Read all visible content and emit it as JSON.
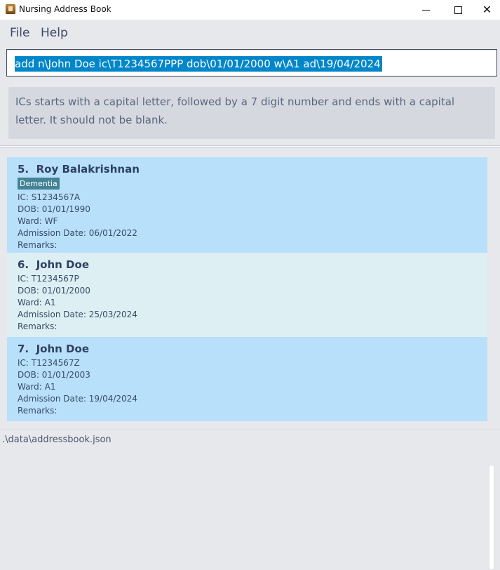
{
  "window": {
    "title": "Nursing Address Book",
    "minimize_symbol": "—",
    "maximize_symbol": "□",
    "close_symbol": "✕"
  },
  "menu": {
    "items": [
      "File",
      "Help"
    ]
  },
  "command": {
    "text": "add n\\John Doe ic\\T1234567PPP dob\\01/01/2000 w\\A1 ad\\19/04/2024"
  },
  "result": {
    "message": "ICs starts with a capital letter, followed by a 7 digit number and ends with a capital letter. It should not be blank."
  },
  "patients": [
    {
      "index": "5.",
      "name": "Roy Balakrishnan",
      "tag": "Dementia",
      "ic": "IC: S1234567A",
      "dob": "DOB: 01/01/1990",
      "ward": "Ward: WF",
      "admission": "Admission Date: 06/01/2022",
      "remarks": "Remarks:"
    },
    {
      "index": "6.",
      "name": "John Doe",
      "ic": "IC: T1234567P",
      "dob": "DOB: 01/01/2000",
      "ward": "Ward: A1",
      "admission": "Admission Date: 25/03/2024",
      "remarks": "Remarks:"
    },
    {
      "index": "7.",
      "name": "John Doe",
      "ic": "IC: T1234567Z",
      "dob": "DOB: 01/01/2003",
      "ward": "Ward: A1",
      "admission": "Admission Date: 19/04/2024",
      "remarks": "Remarks:"
    }
  ],
  "status": {
    "path": ".\\data\\addressbook.json"
  },
  "colors": {
    "selection": "#0086c9",
    "card_blue": "#b8e0fb",
    "card_light": "#ddeff3",
    "tag": "#458295"
  }
}
